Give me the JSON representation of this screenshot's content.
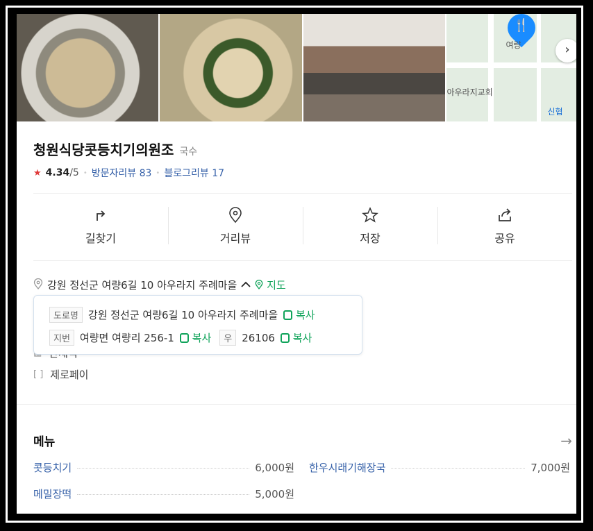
{
  "photos": {
    "map_labels": [
      "여량",
      "아우라지교회",
      "신협"
    ],
    "next_icon": "chevron-right-icon"
  },
  "place": {
    "name": "청원식당콧등치기의원조",
    "category": "국수",
    "rating": "4.34",
    "rating_suffix": "/5",
    "visitor_reviews_label": "방문자리뷰",
    "visitor_reviews_count": "83",
    "blog_reviews_label": "블로그리뷰",
    "blog_reviews_count": "17"
  },
  "actions": [
    {
      "label": "길찾기",
      "icon": "directions-icon"
    },
    {
      "label": "거리뷰",
      "icon": "streetview-pin-icon"
    },
    {
      "label": "저장",
      "icon": "star-icon"
    },
    {
      "label": "공유",
      "icon": "share-icon"
    }
  ],
  "address": {
    "text": "강원 정선군 여량6길 10 아우라지 주례마을",
    "map_link": "지도",
    "road_tag": "도로명",
    "road_address": "강원 정선군 여량6길 10 아우라지 주례마을",
    "lot_tag": "지번",
    "lot_address": "여량면 여량리 256-1",
    "postal_tag": "우",
    "postal_code": "26106",
    "copy_label": "복사"
  },
  "extra": {
    "partial_label": "단체석",
    "zeropay": "제로페이"
  },
  "menu": {
    "title": "메뉴",
    "items": [
      {
        "name": "콧등치기",
        "price": "6,000원"
      },
      {
        "name": "한우시래기해장국",
        "price": "7,000원"
      },
      {
        "name": "메밀장떡",
        "price": "5,000원"
      }
    ]
  },
  "colors": {
    "accent_green": "#10a35a",
    "link_blue": "#3560a8",
    "star_red": "#e03a3a",
    "map_pin": "#1a8cff"
  }
}
